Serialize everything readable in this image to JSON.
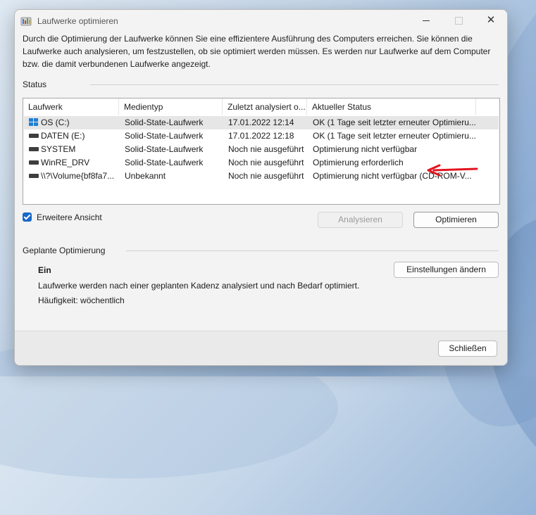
{
  "window": {
    "title": "Laufwerke optimieren"
  },
  "intro": "Durch die Optimierung der Laufwerke können Sie eine effizientere Ausführung des Computers erreichen. Sie können die Laufwerke auch analysieren, um festzustellen, ob sie optimiert werden müssen. Es werden nur Laufwerke auf dem Computer bzw. die damit verbundenen Laufwerke angezeigt.",
  "status": {
    "group_label": "Status",
    "columns": [
      "Laufwerk",
      "Medientyp",
      "Zuletzt analysiert o...",
      "Aktueller Status"
    ],
    "rows": [
      {
        "drive": "OS (C:)",
        "icon": "windows-drive-icon",
        "media": "Solid-State-Laufwerk",
        "last": "17.01.2022 12:14",
        "state": "OK (1 Tage seit letzter erneuter Optimieru..."
      },
      {
        "drive": "DATEN (E:)",
        "icon": "drive-icon",
        "media": "Solid-State-Laufwerk",
        "last": "17.01.2022 12:18",
        "state": "OK (1 Tage seit letzter erneuter Optimieru..."
      },
      {
        "drive": "SYSTEM",
        "icon": "drive-icon",
        "media": "Solid-State-Laufwerk",
        "last": "Noch nie ausgeführt",
        "state": "Optimierung nicht verfügbar"
      },
      {
        "drive": "WinRE_DRV",
        "icon": "drive-icon",
        "media": "Solid-State-Laufwerk",
        "last": "Noch nie ausgeführt",
        "state": "Optimierung erforderlich"
      },
      {
        "drive": "\\\\?\\Volume{bf8fa7...",
        "icon": "drive-icon",
        "media": "Unbekannt",
        "last": "Noch nie ausgeführt",
        "state": "Optimierung nicht verfügbar (CD-ROM-V..."
      }
    ]
  },
  "advanced_view": {
    "label": "Erweitere Ansicht",
    "checked": true
  },
  "buttons": {
    "analyze": "Analysieren",
    "optimize": "Optimieren",
    "change_settings": "Einstellungen ändern",
    "close": "Schließen"
  },
  "schedule": {
    "group_label": "Geplante Optimierung",
    "state": "Ein",
    "description": "Laufwerke werden nach einer geplanten Kadenz analysiert und nach Bedarf optimiert.",
    "frequency": "Häufigkeit: wöchentlich"
  },
  "colors": {
    "accent": "#1967c9",
    "annotation_arrow": "#e3141e",
    "windows_logo": "#1e7fd8"
  }
}
